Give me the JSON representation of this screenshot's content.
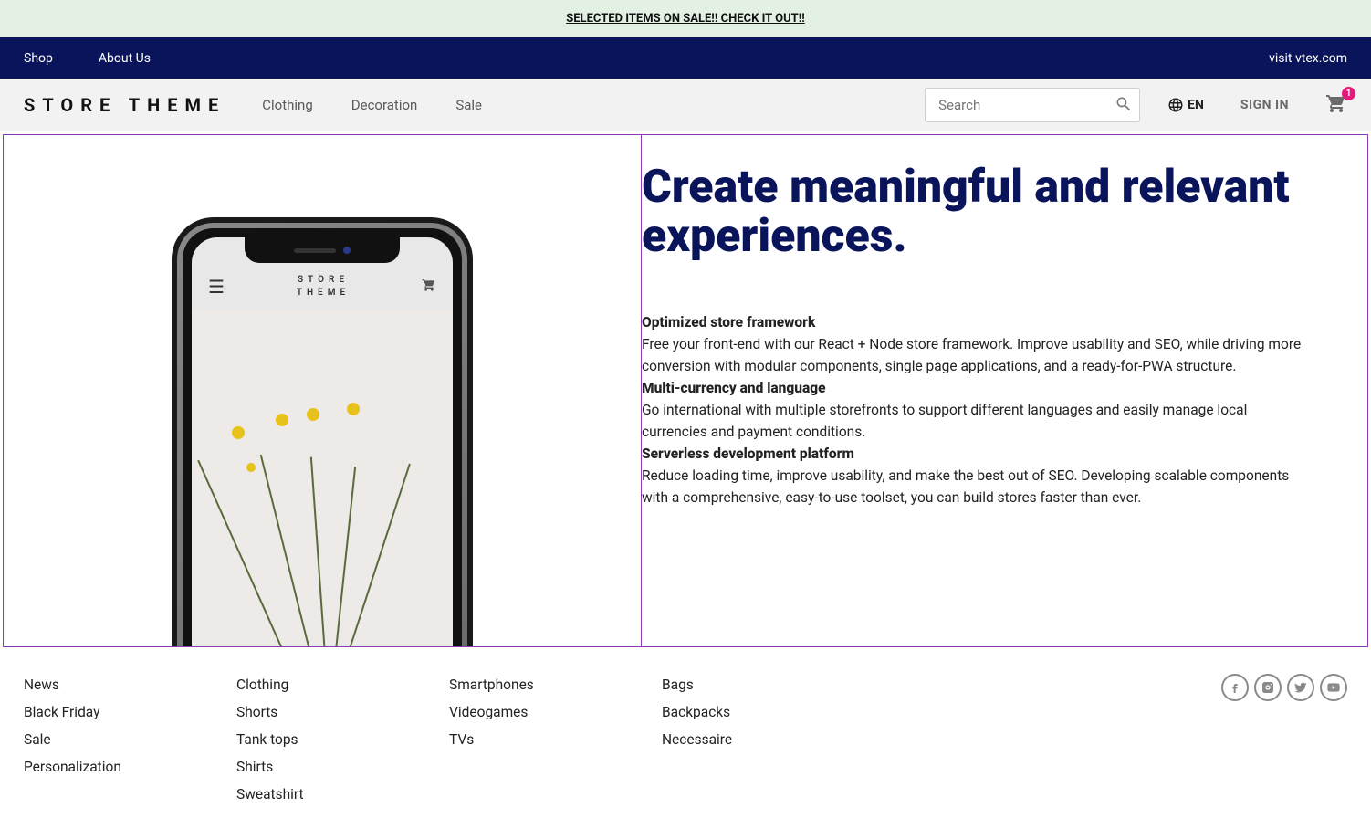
{
  "announce": "SELECTED ITEMS ON SALE!! CHECK IT OUT!!",
  "topbar": {
    "shop": "Shop",
    "about": "About Us",
    "visit": "visit vtex.com"
  },
  "header": {
    "logo": "STORE THEME",
    "nav": {
      "clothing": "Clothing",
      "decoration": "Decoration",
      "sale": "Sale"
    },
    "search_placeholder": "Search",
    "lang": "EN",
    "signin": "SIGN IN",
    "cart_count": "1"
  },
  "phone": {
    "logo_line1": "STORE",
    "logo_line2": "THEME"
  },
  "hero": {
    "title": "Create meaningful and relevant experiences.",
    "f1t": "Optimized store framework",
    "f1b": "Free your front-end with our React + Node store framework. Improve usability and SEO, while driving more conversion with modular components, single page applications, and a ready-for-PWA structure.",
    "f2t": "Multi-currency and language",
    "f2b": "Go international with multiple storefronts to support different languages and easily manage local currencies and payment conditions.",
    "f3t": "Serverless development platform",
    "f3b": "Reduce loading time, improve usability, and make the best out of SEO. Developing scalable components with a comprehensive, easy-to-use toolset, you can build stores faster than ever."
  },
  "footer": {
    "c1": {
      "a": "News",
      "b": "Black Friday",
      "c": "Sale",
      "d": "Personalization"
    },
    "c2": {
      "a": "Clothing",
      "b": "Shorts",
      "c": "Tank tops",
      "d": "Shirts",
      "e": "Sweatshirt"
    },
    "c3": {
      "a": "Smartphones",
      "b": "Videogames",
      "c": "TVs"
    },
    "c4": {
      "a": "Bags",
      "b": "Backpacks",
      "c": "Necessaire"
    }
  },
  "colors": {
    "brand": "#0a145a",
    "accent": "#e31c79",
    "announceBg": "#e2f1e4"
  }
}
